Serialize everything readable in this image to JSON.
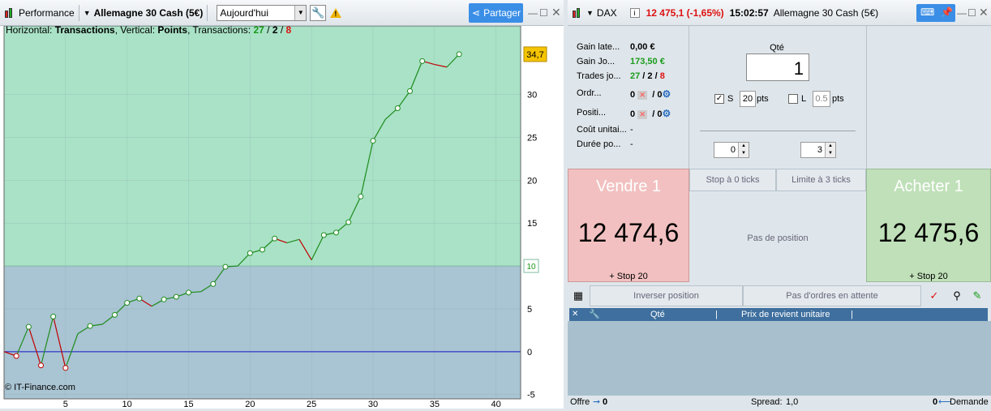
{
  "left_panel": {
    "title": "Performance",
    "instrument": "Allemagne 30 Cash (5€)",
    "period": "Aujourd'hui",
    "share_label": "Partager",
    "info": {
      "prefix_h": "Horizontal: ",
      "h_value": "Transactions",
      "prefix_v": ", Vertical: ",
      "v_value": "Points",
      "prefix_t": ", Transactions: ",
      "t_total": "27",
      "t_win": "2",
      "t_loss": "8"
    },
    "copyright": "© IT-Finance.com",
    "last_value_label": "34,7",
    "ref_level_label": "10"
  },
  "chart_data": {
    "type": "line",
    "x": [
      0,
      1,
      2,
      3,
      4,
      5,
      6,
      7,
      8,
      9,
      10,
      11,
      12,
      13,
      14,
      15,
      16,
      17,
      18,
      19,
      20,
      21,
      22,
      23,
      24,
      25,
      26,
      27,
      28,
      29,
      30,
      31,
      32,
      33,
      34,
      35,
      36,
      37
    ],
    "y": [
      0,
      -0.5,
      2.9,
      -1.6,
      4.1,
      -1.9,
      2.1,
      3.0,
      3.2,
      4.3,
      5.7,
      6.2,
      5.3,
      6.1,
      6.4,
      6.9,
      7.0,
      7.9,
      9.9,
      10.0,
      11.5,
      11.9,
      13.2,
      12.7,
      13.1,
      10.7,
      13.6,
      13.9,
      15.1,
      18.1,
      24.6,
      27.1,
      28.4,
      30.4,
      33.9,
      33.5,
      33.2,
      34.7
    ],
    "segment_colors": [
      "#c00000",
      "#1e8c1e"
    ],
    "xlim": [
      0,
      42
    ],
    "ylim": [
      -5.5,
      38
    ],
    "xticks": [
      5,
      10,
      15,
      20,
      25,
      30,
      35,
      40
    ],
    "yticks": [
      -5,
      0,
      5,
      10,
      15,
      20,
      25,
      30
    ],
    "zero_line_color": "#1515c8",
    "upper_zone_color": "#a9e2c6",
    "lower_zone_color": "#a9c4d2",
    "zone_split": 10,
    "grid": true
  },
  "right_panel": {
    "symbol": "DAX",
    "quote": "12 475,1 (-1,65%)",
    "time": "15:02:57",
    "instrument": "Allemagne 30 Cash (5€)",
    "stats": [
      {
        "label": "Gain late...",
        "value": "0,00 €"
      },
      {
        "label": "Gain Jo...",
        "value": "173,50 €"
      },
      {
        "label": "Trades jo...",
        "v1": "27",
        "v2": "2",
        "v3": "8"
      },
      {
        "label": "Ordr...",
        "a": "0",
        "b": "0"
      },
      {
        "label": "Positi...",
        "a": "0",
        "b": "0"
      },
      {
        "label": "Coût unitai...",
        "value": "-"
      },
      {
        "label": "Durée po...",
        "value": "-"
      }
    ],
    "qty_label": "Qté",
    "qty_value": "1",
    "stop_label": "S",
    "stop_value": "20",
    "limit_label": "L",
    "limit_value": "0.5",
    "pts": "pts",
    "spin_left": "0",
    "spin_right": "3",
    "sell_label": "Vendre 1",
    "sell_price": "12 474,6",
    "sell_stop": "+ Stop 20",
    "buy_label": "Acheter 1",
    "buy_price": "12 475,6",
    "buy_stop": "+ Stop 20",
    "stop_ticks": "Stop à 0 ticks",
    "limit_ticks": "Limite à 3 ticks",
    "no_position": "Pas de position",
    "reverse_position": "Inverser position",
    "no_orders": "Pas d'ordres en attente",
    "col_qty": "Qté",
    "col_price": "Prix de revient unitaire",
    "offer_label": "Offre",
    "offer_value": "0",
    "spread_label": "Spread:",
    "spread_value": "1,0",
    "demand_label": "Demande",
    "demand_value": "0"
  }
}
